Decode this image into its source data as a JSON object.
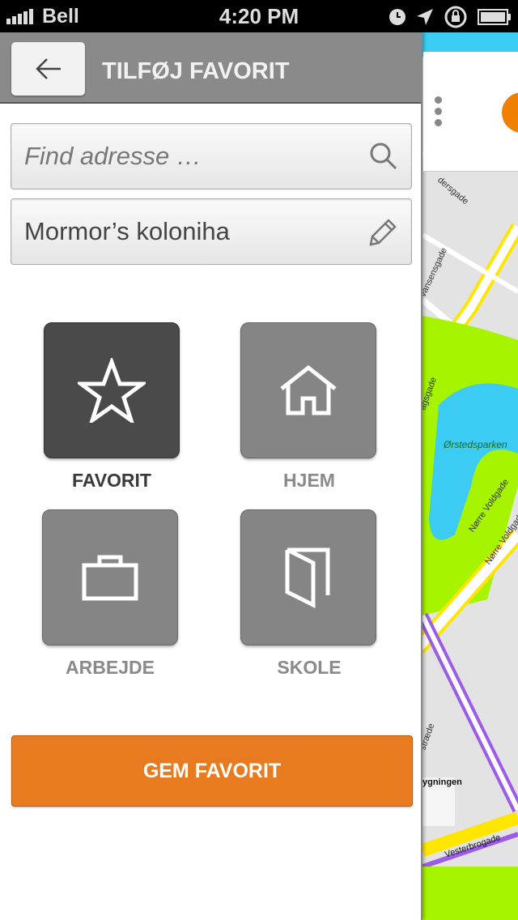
{
  "status": {
    "carrier": "Bell",
    "time": "4:20 PM"
  },
  "header": {
    "title": "TILFØJ FAVORIT"
  },
  "search": {
    "placeholder": "Find adresse …",
    "value": ""
  },
  "name": {
    "value": "Mormor’s koloniha"
  },
  "categories": [
    {
      "label": "FAVORIT",
      "icon": "star-icon",
      "selected": true
    },
    {
      "label": "HJEM",
      "icon": "house-icon",
      "selected": false
    },
    {
      "label": "ARBEJDE",
      "icon": "briefcase-icon",
      "selected": false
    },
    {
      "label": "SKOLE",
      "icon": "book-icon",
      "selected": false
    }
  ],
  "save_label": "GEM FAVORIT",
  "map": {
    "labels": [
      "Ørstedsparken",
      "Nørre Voldgade",
      "Nørre Voldgade",
      "agsgade",
      "vansensgade",
      "dersgade",
      "stræde",
      "ygningen",
      "Vesterbrogade"
    ]
  },
  "colors": {
    "accent": "#e87a1f",
    "header": "#8a8a8a",
    "selected_tile": "#4a4a4a",
    "tile": "#858585"
  }
}
